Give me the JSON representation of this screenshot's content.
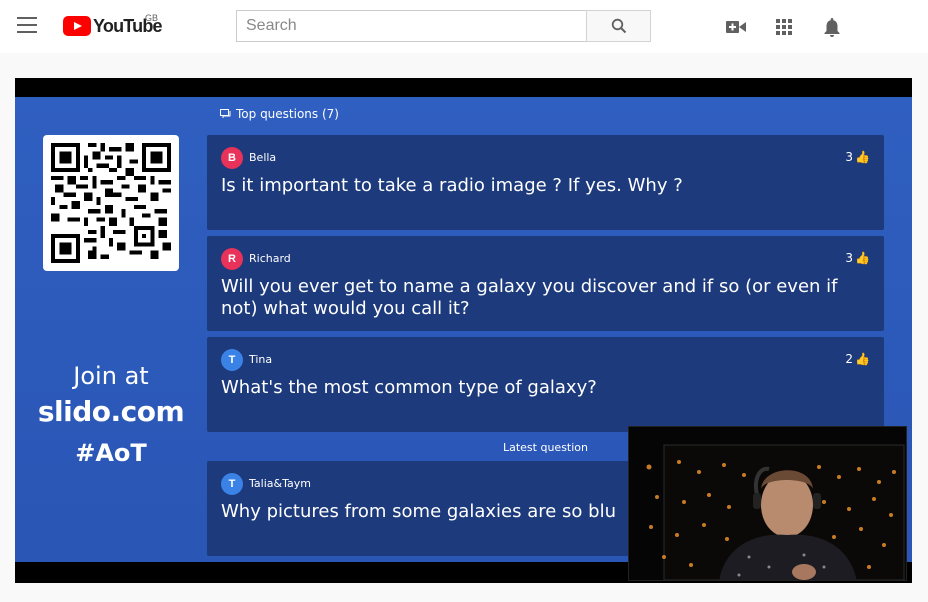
{
  "masthead": {
    "logo_text": "YouTube",
    "region": "GB",
    "search_placeholder": "Search",
    "icons": [
      "menu-icon",
      "search-icon",
      "create-video-icon",
      "apps-icon",
      "notifications-icon"
    ]
  },
  "slide": {
    "join_line1": "Join at",
    "join_line2": "slido.com",
    "join_line3": "#AoT",
    "top_questions_label": "Top questions (7)",
    "latest_label": "Latest question",
    "questions": [
      {
        "initial": "B",
        "author": "Bella",
        "likes": "3",
        "text": "Is it important to take a radio image ? If yes. Why ?",
        "color": "#e8325a"
      },
      {
        "initial": "R",
        "author": "Richard",
        "likes": "3",
        "text": "Will you ever get to name a galaxy you discover and if so (or even if not) what would you call it?",
        "color": "#e8325a"
      },
      {
        "initial": "T",
        "author": "Tina",
        "likes": "2",
        "text": "What's the most common type of galaxy?",
        "color": "#3b82e6"
      }
    ],
    "latest": {
      "initial": "T",
      "author": "Talia&Taym",
      "text": "Why pictures from some galaxies are so blu",
      "color": "#3b82e6"
    }
  },
  "colors": {
    "brand_red": "#ff0000",
    "slide_blue": "#2f5fc0",
    "card_blue": "#1c3a7c"
  }
}
